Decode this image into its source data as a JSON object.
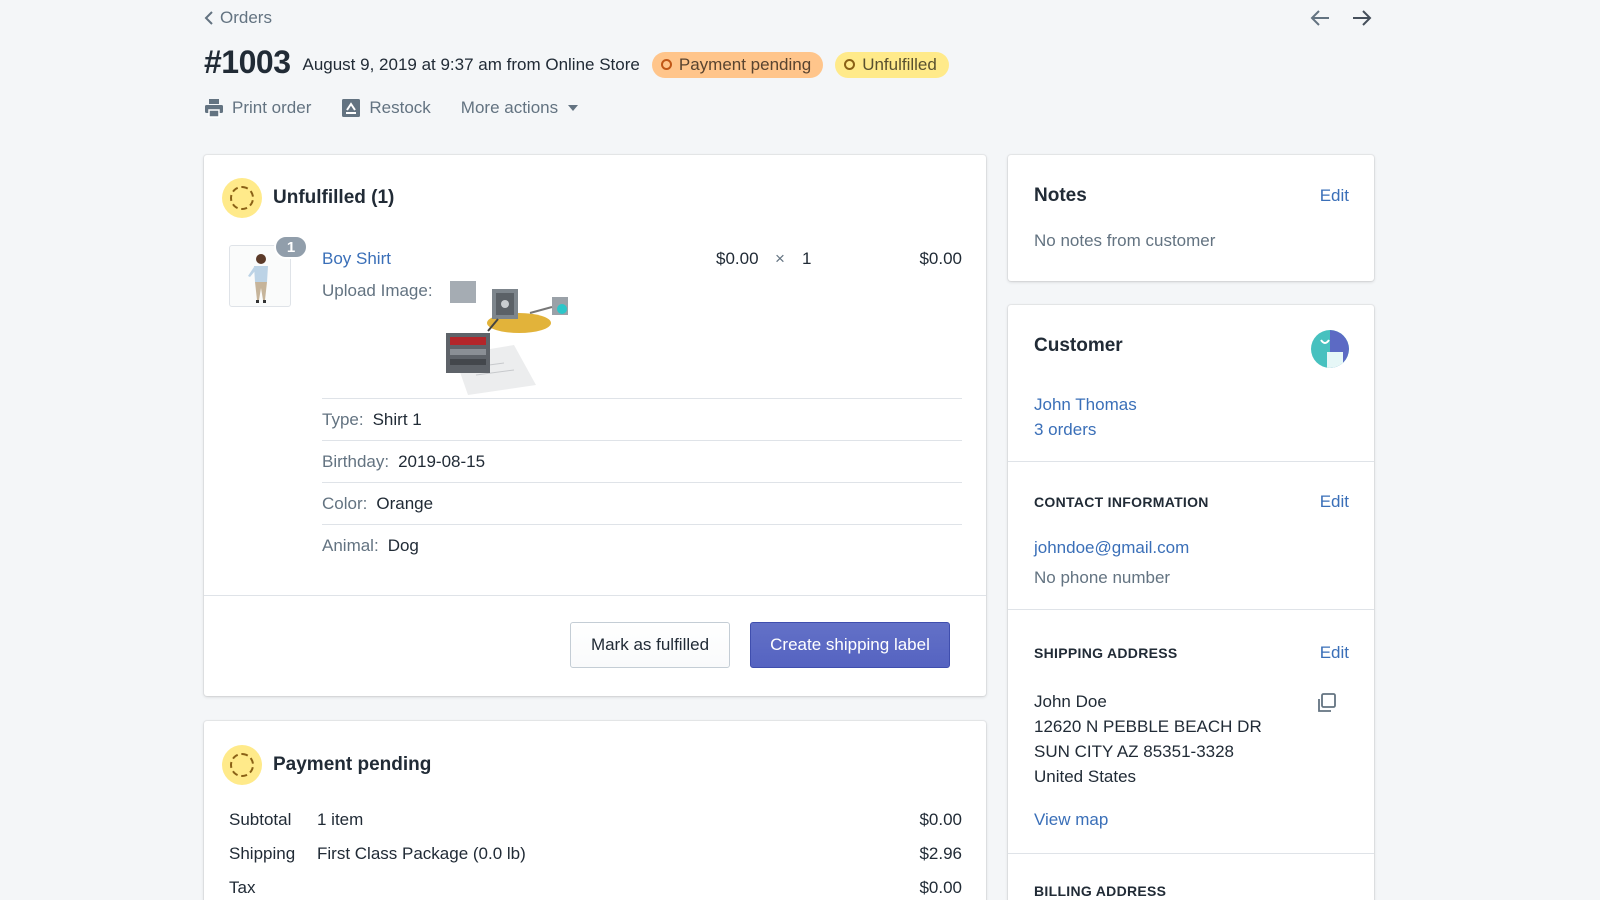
{
  "header": {
    "breadcrumb": "Orders",
    "order_number": "#1003",
    "order_meta": "August 9, 2019 at 9:37 am from Online Store",
    "badges": {
      "payment": "Payment pending",
      "fulfillment": "Unfulfilled"
    },
    "actions": {
      "print": "Print order",
      "restock": "Restock",
      "more": "More actions"
    }
  },
  "fulfillment": {
    "title": "Unfulfilled (1)",
    "item": {
      "quantity_badge": "1",
      "name": "Boy Shirt",
      "unit_price": "$0.00",
      "times": "×",
      "quantity": "1",
      "total": "$0.00",
      "upload_label": "Upload Image:",
      "properties": [
        {
          "key": "Type:",
          "value": "Shirt 1"
        },
        {
          "key": "Birthday:",
          "value": "2019-08-15"
        },
        {
          "key": "Color:",
          "value": "Orange"
        },
        {
          "key": "Animal:",
          "value": "Dog"
        }
      ]
    },
    "buttons": {
      "mark_fulfilled": "Mark as fulfilled",
      "create_label": "Create shipping label"
    }
  },
  "payment": {
    "title": "Payment pending",
    "rows": [
      {
        "label": "Subtotal",
        "detail": "1 item",
        "amount": "$0.00"
      },
      {
        "label": "Shipping",
        "detail": "First Class Package (0.0 lb)",
        "amount": "$2.96"
      },
      {
        "label": "Tax",
        "detail": "",
        "amount": "$0.00"
      }
    ]
  },
  "notes": {
    "title": "Notes",
    "edit": "Edit",
    "text": "No notes from customer"
  },
  "customer": {
    "title": "Customer",
    "name": "John Thomas",
    "orders": "3 orders",
    "contact": {
      "heading": "CONTACT INFORMATION",
      "edit": "Edit",
      "email": "johndoe@gmail.com",
      "phone": "No phone number"
    },
    "shipping": {
      "heading": "SHIPPING ADDRESS",
      "edit": "Edit",
      "lines": [
        "John Doe",
        "12620 N PEBBLE BEACH DR",
        "SUN CITY AZ 85351-3328",
        "United States"
      ],
      "view_map": "View map"
    },
    "billing": {
      "heading": "BILLING ADDRESS"
    }
  },
  "colors": {
    "accent": "#5c6ac4",
    "link": "#3a6fb8",
    "payment_badge": "#ffc58b",
    "fulfillment_badge": "#ffea8a"
  },
  "icons": [
    "chevron-left-icon",
    "arrow-left-icon",
    "arrow-right-icon",
    "printer-icon",
    "restock-icon",
    "caret-down-icon",
    "copy-icon"
  ]
}
